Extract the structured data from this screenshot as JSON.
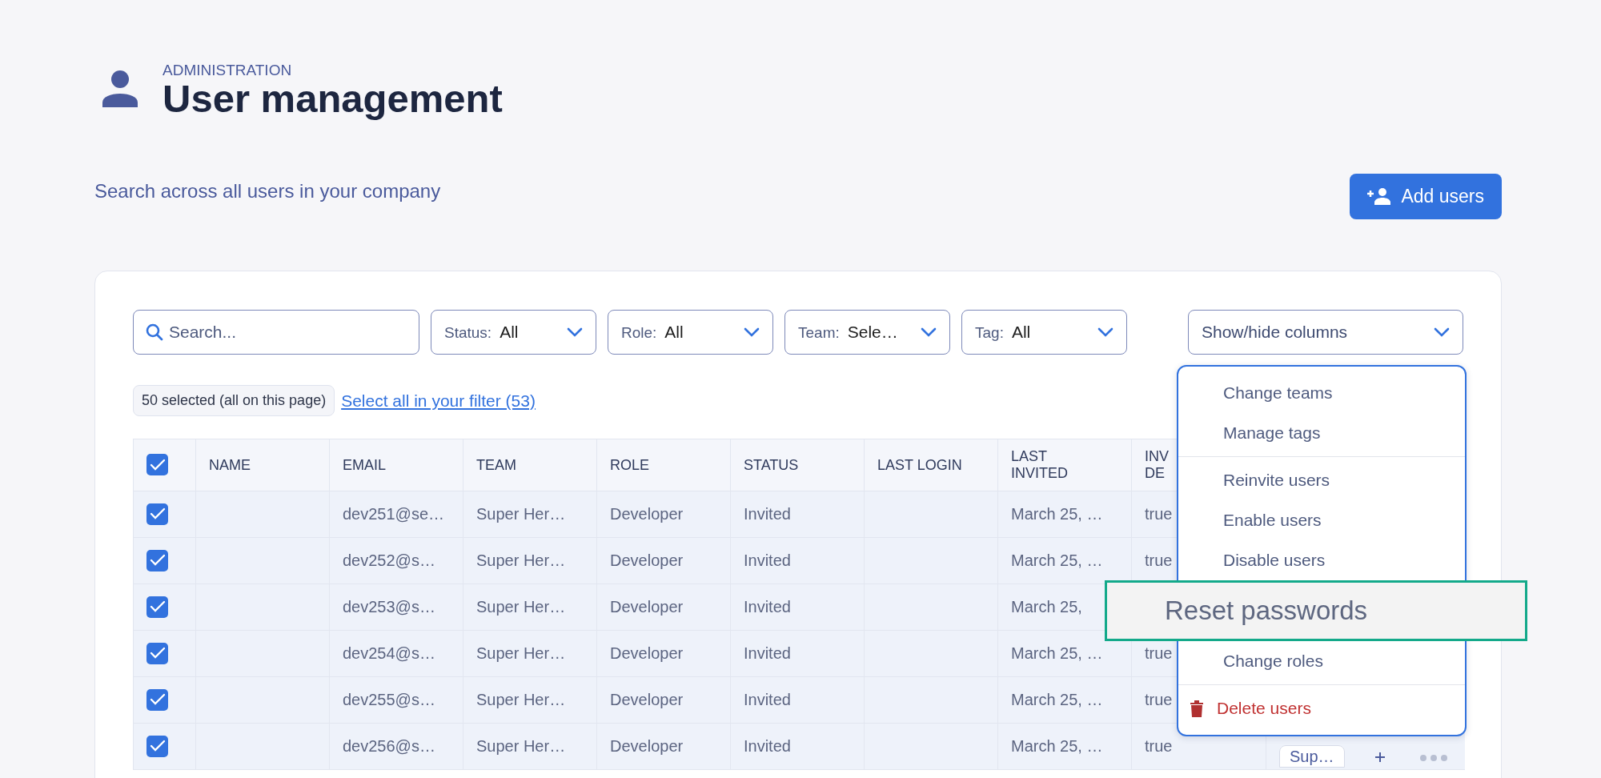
{
  "header": {
    "eyebrow": "ADMINISTRATION",
    "title": "User management",
    "subtitle": "Search across all users in your company"
  },
  "add_button": {
    "label": "Add users"
  },
  "search": {
    "placeholder": "Search..."
  },
  "filters": [
    {
      "label": "Status:",
      "value": "All"
    },
    {
      "label": "Role:",
      "value": "All"
    },
    {
      "label": "Team:",
      "value": "Sele…"
    },
    {
      "label": "Tag:",
      "value": "All"
    }
  ],
  "columns_button": {
    "label": "Show/hide columns"
  },
  "selection": {
    "count_label": "50 selected (all on this page)",
    "link": "Select all in your filter (53)"
  },
  "table": {
    "header_checked": true,
    "columns": [
      "NAME",
      "EMAIL",
      "TEAM",
      "ROLE",
      "STATUS",
      "LAST LOGIN",
      "LAST INVITED",
      "INV DE"
    ],
    "rows": [
      {
        "checked": true,
        "email": "dev251@se…",
        "team": "Super Her…",
        "role": "Developer",
        "status": "Invited",
        "last_invited": "March 25, …",
        "inv_del": "true"
      },
      {
        "checked": true,
        "email": "dev252@s…",
        "team": "Super Her…",
        "role": "Developer",
        "status": "Invited",
        "last_invited": "March 25, …",
        "inv_del": "true"
      },
      {
        "checked": true,
        "email": "dev253@s…",
        "team": "Super Her…",
        "role": "Developer",
        "status": "Invited",
        "last_invited": "March 25,"
      },
      {
        "checked": true,
        "email": "dev254@s…",
        "team": "Super Her…",
        "role": "Developer",
        "status": "Invited",
        "last_invited": "March 25, …",
        "inv_del": "true"
      },
      {
        "checked": true,
        "email": "dev255@s…",
        "team": "Super Her…",
        "role": "Developer",
        "status": "Invited",
        "last_invited": "March 25, …",
        "inv_del": "true"
      },
      {
        "checked": true,
        "email": "dev256@s…",
        "team": "Super Her…",
        "role": "Developer",
        "status": "Invited",
        "last_invited": "March 25, …",
        "inv_del": "true",
        "tag": "Sup…"
      }
    ]
  },
  "menu": {
    "items": [
      {
        "kind": "action",
        "label": "Change teams",
        "highlighted": false
      },
      {
        "kind": "action",
        "label": "Manage tags",
        "highlighted": false
      },
      {
        "kind": "divider"
      },
      {
        "kind": "action",
        "label": "Reinvite users",
        "highlighted": false
      },
      {
        "kind": "action",
        "label": "Enable users",
        "highlighted": false
      },
      {
        "kind": "action",
        "label": "Disable users",
        "highlighted": false
      },
      {
        "kind": "action",
        "label": "Reset passwords",
        "highlighted": true
      },
      {
        "kind": "action",
        "label": "Change roles",
        "highlighted": false
      },
      {
        "kind": "divider"
      },
      {
        "kind": "danger",
        "label": "Delete users",
        "highlighted": false
      }
    ]
  }
}
